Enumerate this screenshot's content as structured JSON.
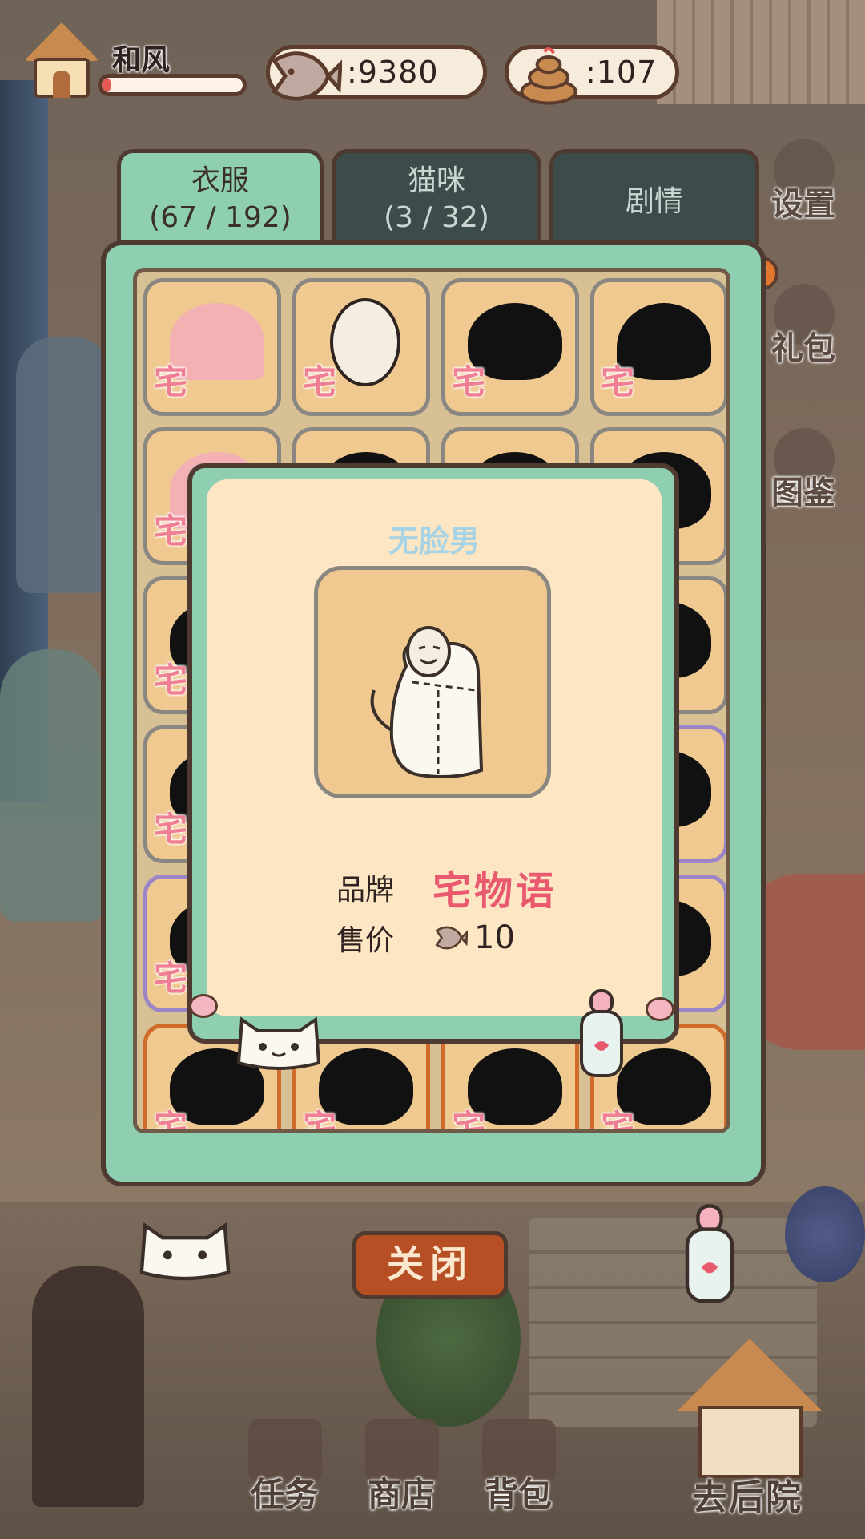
{
  "player": {
    "name": "和风",
    "xp_fraction": 0.06
  },
  "currency": {
    "fish": ":9380",
    "poop": ":107"
  },
  "tabs": [
    {
      "label": "衣服",
      "count": "(67 / 192)"
    },
    {
      "label": "猫咪",
      "count": "(3 / 32)"
    },
    {
      "label": "剧情"
    }
  ],
  "side_menu": {
    "settings": "设置",
    "gift": "礼包",
    "guide": "图鉴",
    "help": "?"
  },
  "grid_brand_mark": "宅",
  "popup": {
    "title": "无脸男",
    "brand_label": "品牌",
    "brand_value": "宅物语",
    "price_label": "售价",
    "price_value": "10"
  },
  "close_label": "关闭",
  "bottom_nav": {
    "tasks": "任务",
    "shop": "商店",
    "bag": "背包",
    "backyard": "去后院"
  },
  "colors": {
    "panel_green": "#8ecfb1",
    "brand_pink": "#e95a6e",
    "close_orange": "#b74f25"
  }
}
